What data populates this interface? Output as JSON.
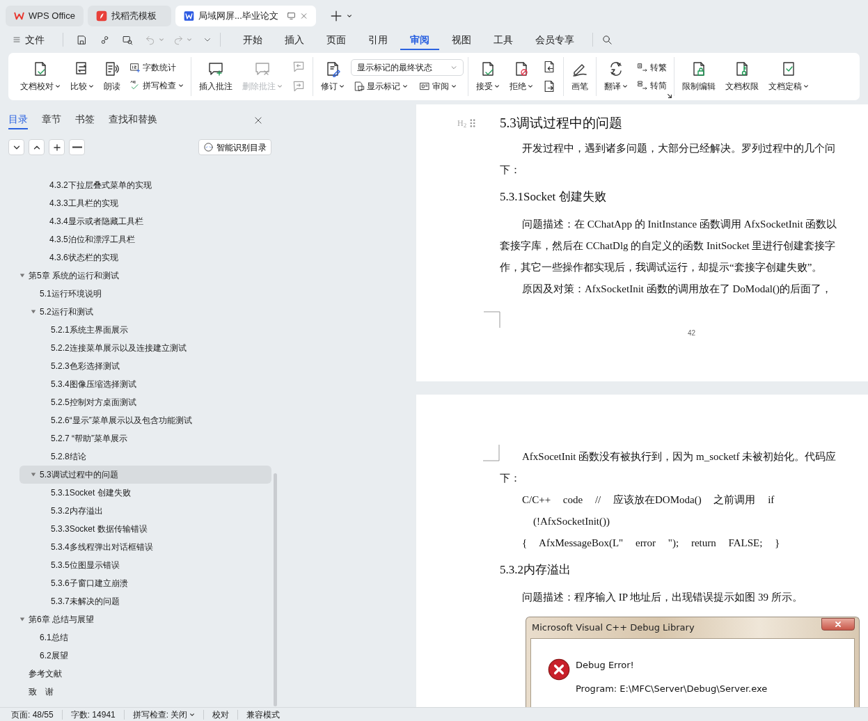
{
  "browser_tabs": [
    {
      "kind": "wps",
      "label": "WPS Office",
      "selected": false
    },
    {
      "kind": "docer",
      "label": "找稻壳模板",
      "selected": false
    },
    {
      "kind": "writer",
      "label": "局域网屏...毕业论文",
      "selected": true
    }
  ],
  "menu": {
    "file": "文件",
    "tabs": [
      {
        "label": "开始",
        "selected": false
      },
      {
        "label": "插入",
        "selected": false
      },
      {
        "label": "页面",
        "selected": false
      },
      {
        "label": "引用",
        "selected": false
      },
      {
        "label": "审阅",
        "selected": true
      },
      {
        "label": "视图",
        "selected": false
      },
      {
        "label": "工具",
        "selected": false
      },
      {
        "label": "会员专享",
        "selected": false
      }
    ]
  },
  "ribbon": [
    {
      "items": [
        {
          "kind": "large",
          "label": "文档校对",
          "dropdown": true,
          "disabled": false
        },
        {
          "kind": "large",
          "label": "比较",
          "dropdown": true,
          "disabled": false
        },
        {
          "kind": "large",
          "label": "朗读",
          "dropdown": false,
          "disabled": false
        },
        {
          "kind": "stack",
          "items": [
            {
              "label": "字数统计",
              "dropdown": false,
              "disabled": false
            },
            {
              "label": "拼写检查",
              "dropdown": true,
              "disabled": false
            }
          ]
        }
      ]
    },
    {
      "items": [
        {
          "kind": "large",
          "label": "插入批注",
          "dropdown": false,
          "disabled": false
        },
        {
          "kind": "large",
          "label": "删除批注",
          "dropdown": true,
          "disabled": true
        },
        {
          "kind": "stack",
          "items": [
            {
              "disabled": true
            },
            {
              "disabled": true
            }
          ]
        }
      ]
    },
    {
      "items": [
        {
          "kind": "large",
          "label": "修订",
          "dropdown": true,
          "disabled": false
        },
        {
          "kind": "select",
          "value": "显示标记的最终状态",
          "items": [
            {
              "label": "显示标记",
              "dropdown": true,
              "disabled": false
            },
            {
              "label": "审阅",
              "dropdown": true,
              "disabled": false
            }
          ]
        }
      ]
    },
    {
      "items": [
        {
          "kind": "large",
          "label": "接受",
          "dropdown": true,
          "disabled": false
        },
        {
          "kind": "large",
          "label": "拒绝",
          "dropdown": true,
          "disabled": false
        },
        {
          "kind": "stack",
          "items": [
            {
              "disabled": false
            },
            {
              "disabled": false
            }
          ]
        }
      ]
    },
    {
      "items": [
        {
          "kind": "large",
          "label": "画笔",
          "dropdown": false,
          "disabled": false
        }
      ]
    },
    {
      "launcher": true,
      "items": [
        {
          "kind": "large",
          "label": "翻译",
          "dropdown": true,
          "disabled": false
        },
        {
          "kind": "stack",
          "items": [
            {
              "label": "转繁",
              "dropdown": false,
              "disabled": false
            },
            {
              "label": "转简",
              "dropdown": false,
              "disabled": false
            }
          ]
        }
      ]
    },
    {
      "items": [
        {
          "kind": "large",
          "label": "限制编辑",
          "dropdown": false,
          "disabled": false
        },
        {
          "kind": "large",
          "label": "文档权限",
          "dropdown": false,
          "disabled": false
        },
        {
          "kind": "large",
          "label": "文档定稿",
          "dropdown": true,
          "disabled": false
        }
      ]
    }
  ],
  "nav": {
    "tabs": [
      {
        "label": "目录",
        "selected": true
      },
      {
        "label": "章节",
        "selected": false
      },
      {
        "label": "书签",
        "selected": false
      },
      {
        "label": "查找和替换",
        "selected": false
      }
    ],
    "smart_toc_button": "智能识别目录",
    "toc": {
      "partial_items": [
        "4.3.2下拉层叠式菜单的实现",
        "4.3.3工具栏的实现",
        "4.3.4显示或者隐藏工具栏",
        "4.3.5泊位和漂浮工具栏",
        "4.3.6状态栏的实现"
      ],
      "items": [
        {
          "label": "第5章 系统的运行和测试",
          "selected": false,
          "expanded": true,
          "children": [
            {
              "label": "5.1运行环境说明",
              "selected": false
            },
            {
              "label": "5.2运行和测试",
              "selected": false,
              "expanded": true,
              "children": [
                {
                  "label": "5.2.1系统主界面展示",
                  "selected": false
                },
                {
                  "label": "5.2.2连接菜单展示以及连接建立测试",
                  "selected": false
                },
                {
                  "label": "5.2.3色彩选择测试",
                  "selected": false
                },
                {
                  "label": "5.3.4图像压缩选择测试",
                  "selected": false
                },
                {
                  "label": "5.2.5控制对方桌面测试",
                  "selected": false
                },
                {
                  "label": "5.2.6“显示”菜单展示以及包含功能测试",
                  "selected": false
                },
                {
                  "label": "5.2.7 “帮助”菜单展示",
                  "selected": false
                },
                {
                  "label": "5.2.8结论",
                  "selected": false
                }
              ]
            },
            {
              "label": "5.3调试过程中的问题",
              "selected": true,
              "expanded": true,
              "children": [
                {
                  "label": "5.3.1Socket 创建失败",
                  "selected": false
                },
                {
                  "label": "5.3.2内存溢出",
                  "selected": false
                },
                {
                  "label": "5.3.3Socket 数据传输错误",
                  "selected": false
                },
                {
                  "label": "5.3.4多线程弹出对话框错误",
                  "selected": false
                },
                {
                  "label": "5.3.5位图显示错误",
                  "selected": false
                },
                {
                  "label": "5.3.6子窗口建立崩溃",
                  "selected": false
                },
                {
                  "label": "5.3.7未解决的问题",
                  "selected": false
                }
              ]
            }
          ]
        },
        {
          "label": "第6章 总结与展望",
          "selected": false,
          "expanded": true,
          "children": [
            {
              "label": "6.1总结",
              "selected": false
            },
            {
              "label": "6.2展望",
              "selected": false
            }
          ]
        },
        {
          "label": "参考文献",
          "selected": false
        },
        {
          "label": "致　谢",
          "selected": false
        }
      ]
    }
  },
  "document": {
    "pages": [
      {
        "page_number": "42",
        "blocks": [
          {
            "kind": "heading2",
            "text": "5.3调试过程中的问题",
            "level_marker": "H$_{2}$"
          },
          {
            "kind": "para",
            "text": "开发过程中，遇到诸多问题，大部分已经解决。罗列过程中的几个问"
          },
          {
            "kind": "cont",
            "text": "下："
          },
          {
            "kind": "heading3",
            "text": "5.3.1Socket 创建失败"
          },
          {
            "kind": "para",
            "text": "问题描述：在 CChatApp 的 InitInstance 函数调用 AfxSocketInit 函数以"
          },
          {
            "kind": "cont",
            "text": "套接字库，然后在 CChatDlg 的自定义的函数 InitSocket 里进行创建套接字"
          },
          {
            "kind": "cont",
            "text": "作，其它一些操作都实现后，我调试运行，却提示“套接字创建失败”。"
          },
          {
            "kind": "para",
            "text": "原因及对策：AfxSocketInit 函数的调用放在了 DoModal()的后面了，"
          }
        ]
      },
      {
        "blocks": [
          {
            "kind": "para",
            "text": "AfxSocetInit 函数没有被执行到，因为 m_socketf 未被初始化。代码应"
          },
          {
            "kind": "cont",
            "text": "下："
          },
          {
            "kind": "code",
            "text": "C/C++ code // 应该放在DOModa() 之前调用 if"
          },
          {
            "kind": "code-cont",
            "text": "(!AfxSocketInit())"
          },
          {
            "kind": "code",
            "text": "{ AfxMessageBox(L\" error \"); return FALSE; }"
          },
          {
            "kind": "heading3",
            "text": "5.3.2内存溢出"
          },
          {
            "kind": "para",
            "text": "问题描述：程序输入 IP 地址后，出现错误提示如图 39 所示。"
          }
        ],
        "figure": {
          "title": "Microsoft Visual C++ Debug Library",
          "heading": "Debug Error!",
          "lines": [
            "Program: E:\\MFC\\Server\\Debug\\Server.exe"
          ]
        }
      }
    ]
  },
  "status_bar": [
    {
      "label": "页面: 48/55"
    },
    {
      "label": "字数: 14941"
    },
    {
      "label": "拼写检查: 关闭",
      "dropdown": true
    },
    {
      "label": "校对"
    },
    {
      "label": "兼容模式"
    }
  ]
}
